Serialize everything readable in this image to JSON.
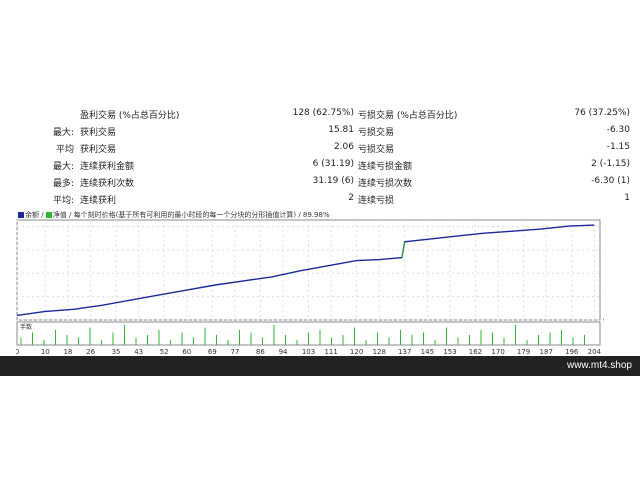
{
  "stats": {
    "rows": [
      {
        "prefix": "",
        "label1": "盈利交易 (%占总百分比)",
        "value1": "128 (62.75%)",
        "label2": "亏损交易 (%占总百分比)",
        "value2": "76 (37.25%)"
      },
      {
        "prefix": "最大:",
        "label1": "获利交易",
        "value1": "15.81",
        "label2": "亏损交易",
        "value2": "-6.30"
      },
      {
        "prefix": "平均",
        "label1": "获利交易",
        "value1": "2.06",
        "label2": "亏损交易",
        "value2": "-1.15"
      },
      {
        "prefix": "最大:",
        "label1": "连续获利金额",
        "value1": "6 (31.19)",
        "label2": "连续亏损金额",
        "value2": "2 (-1.15)"
      },
      {
        "prefix": "最多:",
        "label1": "连续获利次数",
        "value1": "31.19 (6)",
        "label2": "连续亏损次数",
        "value2": "-6.30 (1)"
      },
      {
        "prefix": "平均:",
        "label1": "连续获利",
        "value1": "2",
        "label2": "连续亏损",
        "value2": "1"
      }
    ]
  },
  "chart_header": {
    "legend_balance": "余额",
    "legend_equity": "净值",
    "description": "每个刻时价格(基于所有可利用的最小时段的每一个分块的分形插值计算)",
    "quality": "89.98%"
  },
  "colors": {
    "balance": "#1a2a9a",
    "equity": "#2db82d",
    "volume_bars": "#2db82d",
    "footer_bg": "#222222"
  },
  "chart_data": {
    "type": "line",
    "y_ticks": [
      991,
      1037,
      1083,
      1129,
      1175
    ],
    "ylim": [
      991,
      1188
    ],
    "x_ticks": [
      0,
      10,
      18,
      26,
      35,
      43,
      52,
      60,
      69,
      77,
      86,
      94,
      103,
      111,
      120,
      128,
      137,
      145,
      153,
      162,
      170,
      179,
      187,
      196,
      204
    ],
    "xlim": [
      0,
      206
    ],
    "series": [
      {
        "name": "余额",
        "points": [
          [
            0,
            1000
          ],
          [
            10,
            1008
          ],
          [
            20,
            1012
          ],
          [
            30,
            1020
          ],
          [
            40,
            1030
          ],
          [
            50,
            1040
          ],
          [
            60,
            1050
          ],
          [
            70,
            1060
          ],
          [
            80,
            1068
          ],
          [
            90,
            1076
          ],
          [
            100,
            1088
          ],
          [
            110,
            1098
          ],
          [
            120,
            1108
          ],
          [
            128,
            1110
          ],
          [
            136,
            1114
          ],
          [
            137,
            1145
          ],
          [
            145,
            1150
          ],
          [
            155,
            1156
          ],
          [
            165,
            1162
          ],
          [
            175,
            1166
          ],
          [
            185,
            1170
          ],
          [
            195,
            1176
          ],
          [
            204,
            1178
          ]
        ]
      }
    ],
    "volume_label": "手数",
    "volume_values": [
      3,
      5,
      2,
      6,
      4,
      3,
      7,
      2,
      5,
      8,
      3,
      4,
      6,
      2,
      5,
      3,
      7,
      4,
      2,
      6,
      5,
      3,
      8,
      4,
      2,
      5,
      6,
      3,
      4,
      7,
      2,
      5,
      3,
      6,
      4,
      5,
      2,
      7,
      3,
      4,
      6,
      5,
      3,
      8,
      2,
      4,
      5,
      6,
      3,
      4
    ]
  },
  "footer": {
    "watermark": "www.mt4.shop"
  }
}
